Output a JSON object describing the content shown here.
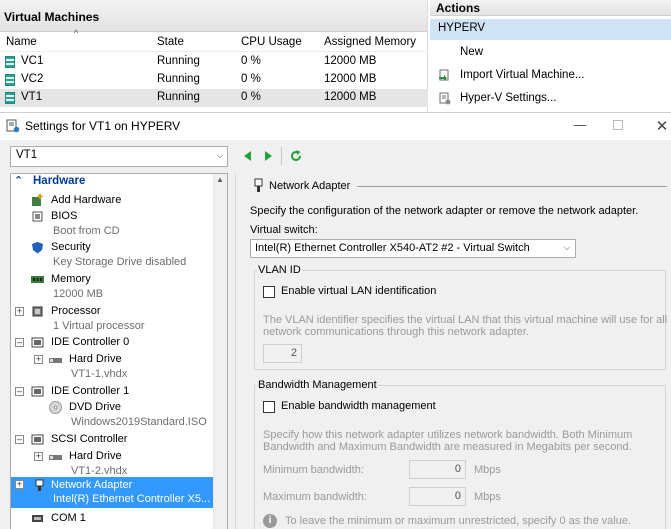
{
  "manager": {
    "vm_panel_title": "Virtual Machines",
    "columns": [
      "Name",
      "State",
      "CPU Usage",
      "Assigned Memory"
    ],
    "rows": [
      {
        "name": "VC1",
        "state": "Running",
        "cpu": "0 %",
        "memory": "12000 MB",
        "selected": false
      },
      {
        "name": "VC2",
        "state": "Running",
        "cpu": "0 %",
        "memory": "12000 MB",
        "selected": false
      },
      {
        "name": "VT1",
        "state": "Running",
        "cpu": "0 %",
        "memory": "12000 MB",
        "selected": true
      }
    ],
    "actions_title": "Actions",
    "host": "HYPERV",
    "actions": [
      "New",
      "Import Virtual Machine...",
      "Hyper-V Settings..."
    ]
  },
  "dialog": {
    "title": "Settings for VT1 on HYPERV",
    "vm_selected": "VT1",
    "tree": {
      "hardware_label": "Hardware",
      "add_hardware": "Add Hardware",
      "bios": "BIOS",
      "bios_sub": "Boot from CD",
      "security": "Security",
      "security_sub": "Key Storage Drive disabled",
      "memory": "Memory",
      "memory_sub": "12000 MB",
      "processor": "Processor",
      "processor_sub": "1 Virtual processor",
      "ide0": "IDE Controller 0",
      "ide0_drive": "Hard Drive",
      "ide0_drive_sub": "VT1-1.vhdx",
      "ide1": "IDE Controller 1",
      "ide1_drive": "DVD Drive",
      "ide1_drive_sub": "Windows2019Standard.ISO",
      "scsi": "SCSI Controller",
      "scsi_drive": "Hard Drive",
      "scsi_drive_sub": "VT1-2.vhdx",
      "network": "Network Adapter",
      "network_sub": "Intel(R) Ethernet Controller X5...",
      "com1": "COM 1"
    },
    "panel": {
      "heading": "Network Adapter",
      "description": "Specify the configuration of the network adapter or remove the network adapter.",
      "switch_label": "Virtual switch:",
      "switch_value": "Intel(R) Ethernet Controller X540-AT2 #2 - Virtual Switch",
      "vlan_group": "VLAN ID",
      "vlan_checkbox": "Enable virtual LAN identification",
      "vlan_help_1": "The VLAN identifier specifies the virtual LAN that this virtual machine will use for all",
      "vlan_help_2": "network communications through this network adapter.",
      "vlan_value": "2",
      "bw_group": "Bandwidth Management",
      "bw_checkbox": "Enable bandwidth management",
      "bw_help_1": "Specify how this network adapter utilizes network bandwidth. Both Minimum",
      "bw_help_2": "Bandwidth and Maximum Bandwidth are measured in Megabits per second.",
      "min_label": "Minimum bandwidth:",
      "min_value": "0",
      "max_label": "Maximum bandwidth:",
      "max_value": "0",
      "unit": "Mbps",
      "info_text": "To leave the minimum or maximum unrestricted, specify 0 as the value."
    }
  }
}
